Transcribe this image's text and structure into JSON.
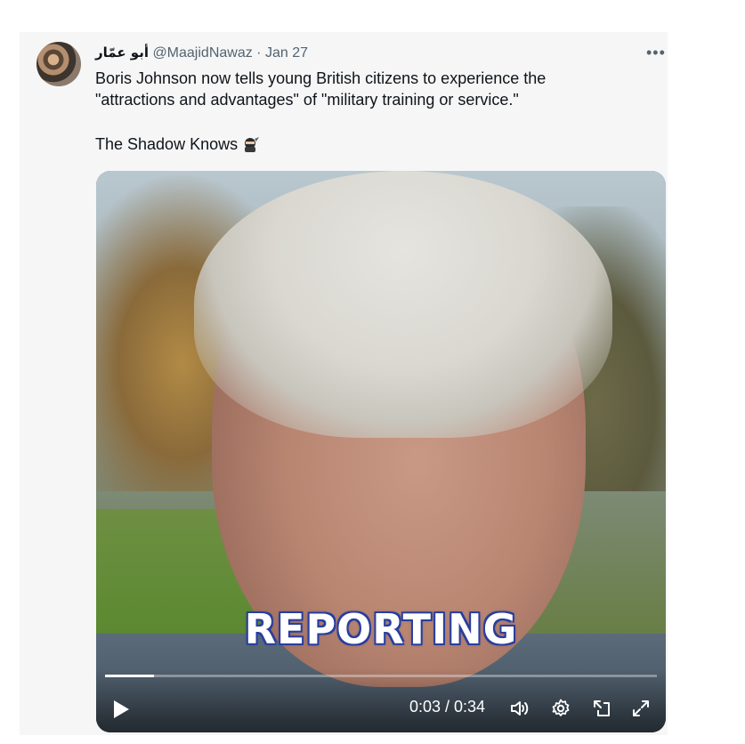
{
  "tweet": {
    "display_name": "أبو عمّار",
    "handle": "@MaajidNawaz",
    "separator": "·",
    "date": "Jan 27",
    "more_label": "•••",
    "text_line1": "Boris Johnson now tells young British citizens to experience the \"attractions and advantages\" of \"military training or service.\"",
    "text_line2": "The Shadow Knows",
    "emoji": "ninja-icon"
  },
  "video": {
    "caption": "REPORTING",
    "time": "0:03 / 0:34",
    "progress_fraction": 0.088,
    "icons": [
      "play-icon",
      "volume-icon",
      "settings-icon",
      "pip-icon",
      "fullscreen-icon"
    ]
  },
  "colors": {
    "text": "#0f1419",
    "muted": "#536471",
    "caption_outline": "#2a3f9e"
  }
}
